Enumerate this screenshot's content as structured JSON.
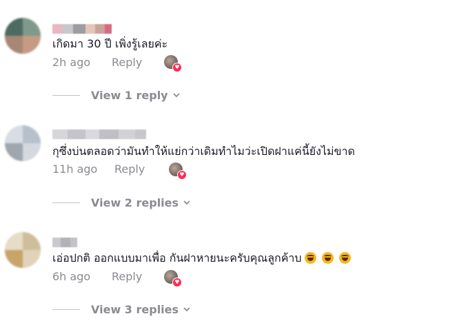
{
  "comments": [
    {
      "text": "เกิดมา 30 ปี เพิ่งรู้เลยค่ะ",
      "emoji_count": 0,
      "timestamp": "2h ago",
      "reply_label": "Reply",
      "view_replies_label": "View 1 reply"
    },
    {
      "text": "กุซึ่งบ่นตลอดว่ามันทำให้แย่กว่าเดิมทำไมว่ะเปิดฝาแค่นี้ยังไม่ขาด",
      "emoji_count": 0,
      "timestamp": "11h ago",
      "reply_label": "Reply",
      "view_replies_label": "View 2 replies"
    },
    {
      "text": "เอ่อปกติ ออกแบบมาเพื่อ กันฝาหายนะครับคุณลูกค้าบ",
      "emoji_count": 3,
      "emoji_icon": "face-with-tears-of-joy-emoji",
      "timestamp": "6h ago",
      "reply_label": "Reply",
      "view_replies_label": "View 3 replies"
    }
  ],
  "colors": {
    "text": "#161823",
    "secondary": "#8a8b91",
    "like_badge": "#fe2c55"
  },
  "icons": {
    "creator_like": "creator-liked-avatar-icon",
    "like_badge": "heart-icon",
    "expand": "chevron-down-icon"
  }
}
